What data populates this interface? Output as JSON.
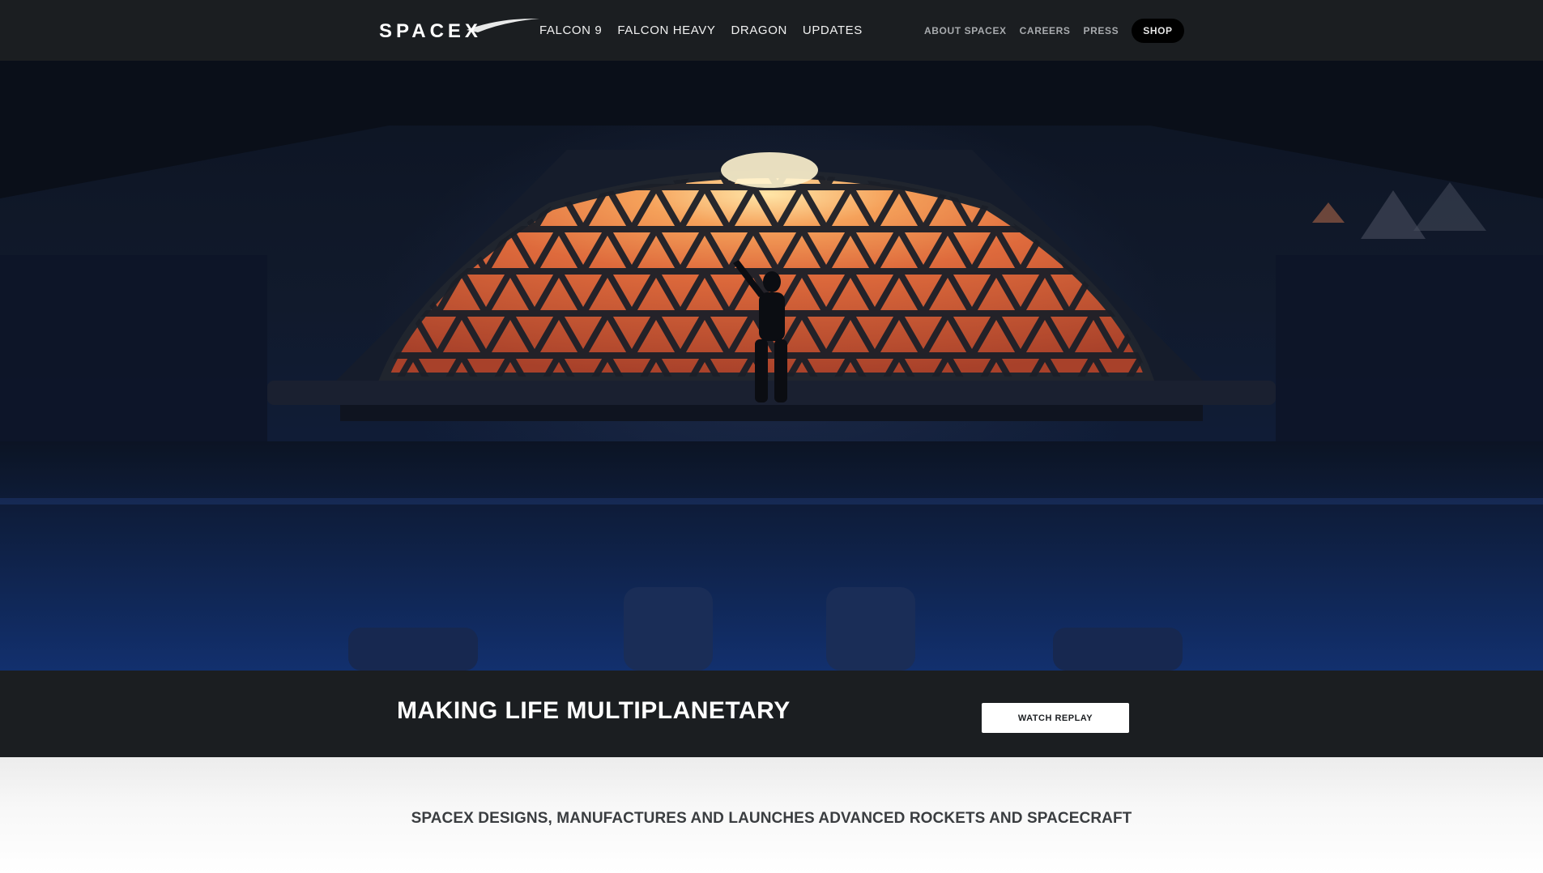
{
  "brand": {
    "logo_text": "SPACEX"
  },
  "nav": {
    "main": [
      {
        "label": "FALCON 9"
      },
      {
        "label": "FALCON HEAVY"
      },
      {
        "label": "DRAGON"
      },
      {
        "label": "UPDATES"
      }
    ],
    "secondary": [
      {
        "label": "ABOUT SPACEX"
      },
      {
        "label": "CAREERS"
      },
      {
        "label": "PRESS"
      },
      {
        "label": "SHOP"
      }
    ]
  },
  "banner": {
    "title": "MAKING LIFE MULTIPLANETARY",
    "button_label": "WATCH REPLAY"
  },
  "tagline": "SPACEX DESIGNS, MANUFACTURES AND LAUNCHES ADVANCED ROCKETS AND SPACECRAFT",
  "colors": {
    "header_bg": "#1b1e21",
    "hero_window": "#d9643a",
    "button_bg": "#ffffff"
  }
}
